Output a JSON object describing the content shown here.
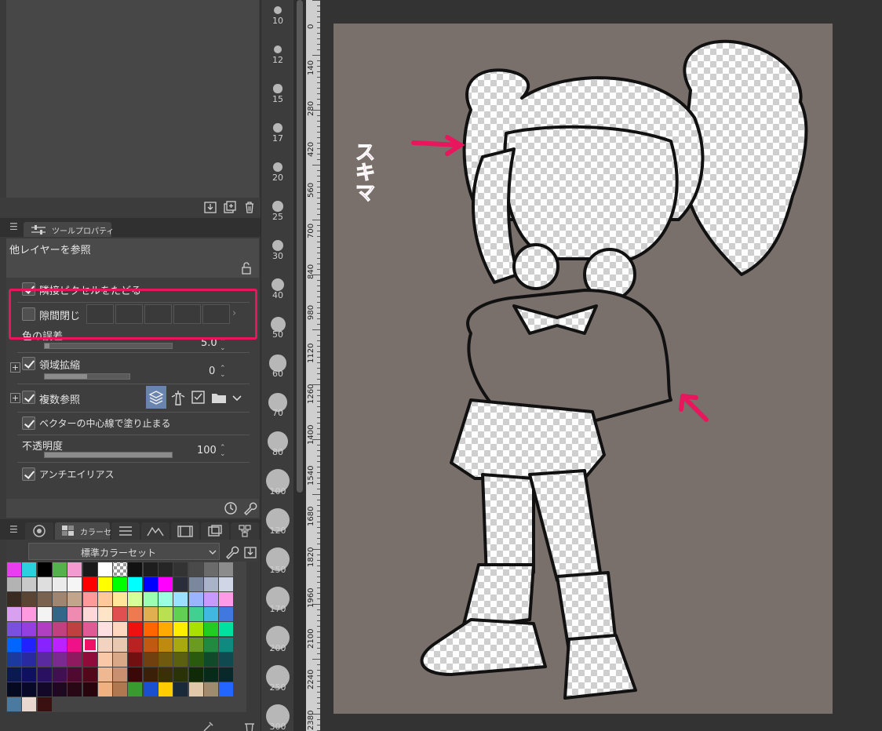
{
  "layer_panel": {
    "icons": [
      "layer-color-icon",
      "import-icon",
      "duplicate-icon",
      "trash-icon"
    ]
  },
  "tool_property": {
    "tab_label": "ツールプロパティ",
    "title": "他レイヤーを参照",
    "rows": {
      "partial_hidden_label": "隣接ピクセルをたどる",
      "gap_close": {
        "label": "隙間閉じ",
        "checked": false
      },
      "color_margin": {
        "label": "色の誤差",
        "value": "5.0",
        "fraction": 0.02
      },
      "area_scaling": {
        "label": "領域拡縮",
        "value": "0",
        "checked": true,
        "fraction": 0.5
      },
      "multi_ref": {
        "label": "複数参照",
        "checked": true
      },
      "vector_stop": {
        "label": "ベクターの中心線で塗り止まる",
        "checked": true
      },
      "opacity": {
        "label": "不透明度",
        "value": "100",
        "fraction": 1.0
      },
      "antialias": {
        "label": "アンチエイリアス",
        "checked": true
      }
    }
  },
  "color_set": {
    "tab_label": "カラーセ",
    "selected": "標準カラーセット"
  },
  "brush_sizes": [
    "10",
    "12",
    "15",
    "17",
    "20",
    "25",
    "30",
    "40",
    "50",
    "60",
    "70",
    "80",
    "100",
    "120",
    "150",
    "170",
    "200",
    "250",
    "300"
  ],
  "ruler_labels": [
    "0",
    "140",
    "280",
    "420",
    "560",
    "700",
    "840",
    "980",
    "1120",
    "1260",
    "1400",
    "1540",
    "1680",
    "1820",
    "1960",
    "2100",
    "2240",
    "2380"
  ],
  "canvas": {
    "annotation_text": "スキマ",
    "bg_color": "#7a706b",
    "accent_color": "#e8175d"
  }
}
